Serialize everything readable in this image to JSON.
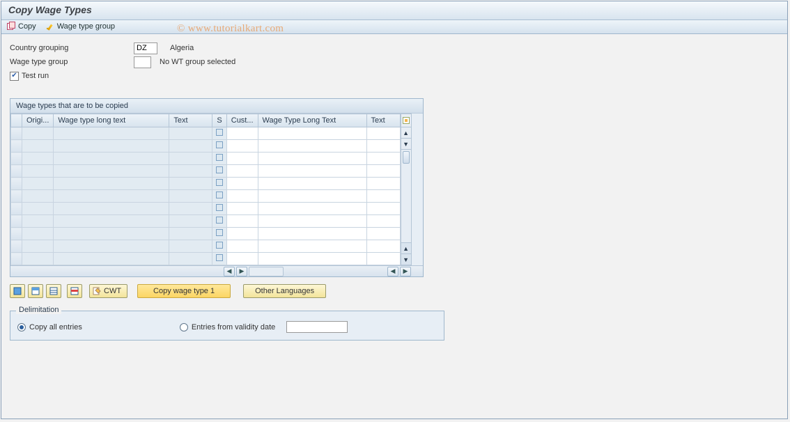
{
  "title": "Copy Wage Types",
  "toolbar": {
    "copy_label": "Copy",
    "wage_type_group_label": "Wage type group"
  },
  "watermark": "©  www.tutorialkart.com",
  "form": {
    "country_grouping_label": "Country grouping",
    "country_grouping_value": "DZ",
    "country_grouping_text": "Algeria",
    "wage_type_group_label": "Wage type group",
    "wage_type_group_value": "",
    "wage_type_group_text": "No WT group selected",
    "test_run_label": "Test run",
    "test_run_checked": true
  },
  "table": {
    "title": "Wage types that are to be copied",
    "columns": {
      "orig": "Origi...",
      "long_text": "Wage type long text",
      "text": "Text",
      "s": "S",
      "cust": "Cust...",
      "long_text2": "Wage Type Long Text",
      "text2": "Text"
    },
    "row_count": 11
  },
  "buttons": {
    "cwt": "CWT",
    "copy_wt1": "Copy wage type 1",
    "other_lang": "Other Languages"
  },
  "delimitation": {
    "title": "Delimitation",
    "copy_all_label": "Copy all entries",
    "from_date_label": "Entries from validity date",
    "date_value": "",
    "selected": "all"
  }
}
